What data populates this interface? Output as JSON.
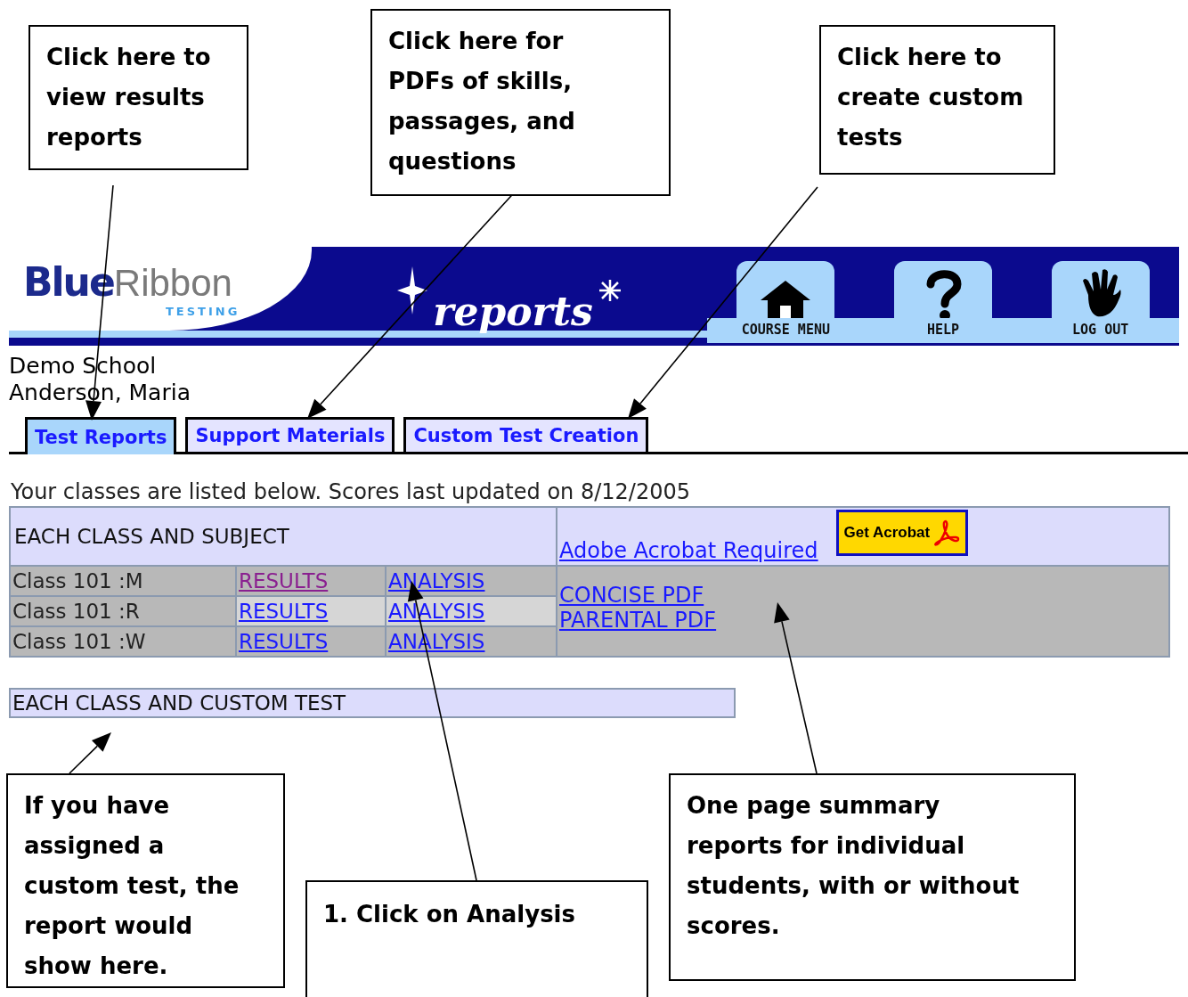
{
  "annotations": [
    {
      "text": "Click here to view results reports"
    },
    {
      "text": "Click here for PDFs of skills, passages, and questions"
    },
    {
      "text": "Click here to create custom tests"
    },
    {
      "text": "If you have assigned a custom test, the report would show here."
    },
    {
      "text": "1. Click on Analysis"
    },
    {
      "text": "One page summary reports for individual students, with or without scores."
    }
  ],
  "header": {
    "logo": {
      "word_1": "Blue",
      "word_2": "Ribbon",
      "tagline": "TESTING"
    },
    "title": "reports",
    "nav": [
      {
        "label": "COURSE MENU"
      },
      {
        "label": "HELP"
      },
      {
        "label": "LOG OUT"
      }
    ]
  },
  "school": "Demo School",
  "user": "Anderson, Maria",
  "tabs": [
    {
      "label": "Test Reports",
      "selected": true
    },
    {
      "label": "Support Materials",
      "selected": false
    },
    {
      "label": "Custom Test Creation",
      "selected": false
    }
  ],
  "intro": "Your classes are listed below. Scores last updated on 8/12/2005",
  "table": {
    "heading": "EACH CLASS AND SUBJECT",
    "acrobat_link": "Adobe Acrobat Required",
    "acrobat_button": "Get Acrobat",
    "rows": [
      {
        "class": "Class 101 :M",
        "results": "RESULTS",
        "analysis": "ANALYSIS",
        "visited": true
      },
      {
        "class": "Class 101 :R",
        "results": "RESULTS",
        "analysis": "ANALYSIS",
        "visited": false
      },
      {
        "class": "Class 101 :W",
        "results": "RESULTS",
        "analysis": "ANALYSIS",
        "visited": false
      }
    ],
    "pdf_links": [
      "CONCISE PDF",
      "PARENTAL PDF"
    ]
  },
  "custom_heading": "EACH CLASS AND CUSTOM TEST"
}
